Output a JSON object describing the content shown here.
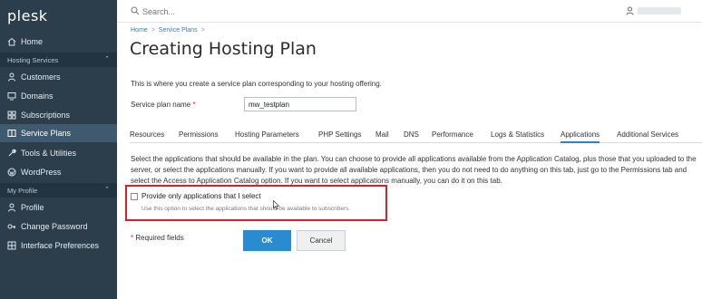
{
  "sidebar": {
    "logo": "plesk",
    "items": [
      {
        "label": "Home",
        "icon": "home-icon"
      },
      {
        "label": "Customers",
        "icon": "user-icon"
      },
      {
        "label": "Domains",
        "icon": "monitor-icon"
      },
      {
        "label": "Subscriptions",
        "icon": "grid-icon"
      },
      {
        "label": "Service Plans",
        "icon": "book-icon"
      },
      {
        "label": "Tools & Utilities",
        "icon": "wrench-icon"
      },
      {
        "label": "WordPress",
        "icon": "wordpress-icon"
      },
      {
        "label": "Profile",
        "icon": "user-icon"
      },
      {
        "label": "Change Password",
        "icon": "key-icon"
      },
      {
        "label": "Interface Preferences",
        "icon": "grid-icon"
      }
    ],
    "sections": {
      "hosting": "Hosting Services",
      "profile": "My Profile"
    },
    "colors": {
      "background": "#2c3e4c",
      "active": "#3f5a6e"
    }
  },
  "topbar": {
    "search_placeholder": "Search..."
  },
  "main": {
    "breadcrumb": [
      "Home",
      "Service Plans"
    ],
    "title": "Creating Hosting Plan",
    "intro": "This is where you create a service plan corresponding to your hosting offering.",
    "plan_name_label": "Service plan name",
    "required_mark": "*",
    "plan_name_value": "mw_testplan",
    "tabs": [
      "Resources",
      "Permissions",
      "Hosting Parameters",
      "PHP Settings",
      "Mail",
      "DNS",
      "Performance",
      "Logs & Statistics",
      "Applications",
      "Additional Services"
    ],
    "active_tab": "Applications",
    "description": "Select the applications that should be available in the plan. You can choose to provide all applications available from the Application Catalog, plus those that you uploaded to the server, or select the applications manually. If you want to provide all available applications, then you do not need to do anything on this tab, just go to the Permissions tab and select the Access to Application Catalog option. If you want to select applications manually, you can do it on this tab.",
    "checkbox_label": "Provide only applications that I select",
    "checkbox_hint": "Use this option to select the applications that should be available to subscribers.",
    "required_note": "Required fields",
    "ok_label": "OK",
    "cancel_label": "Cancel"
  }
}
